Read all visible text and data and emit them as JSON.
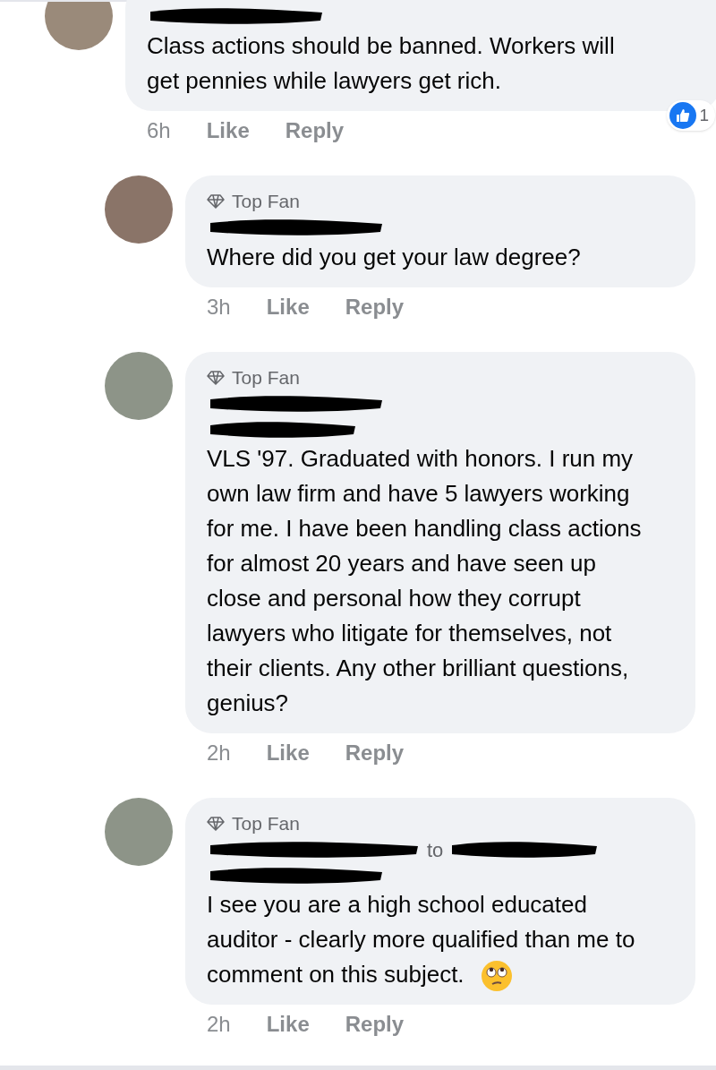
{
  "comments": [
    {
      "kind": "top-level",
      "body": "Class actions should be banned. Workers will get pennies while lawyers get rich.",
      "time": "6h",
      "like": "Like",
      "reply": "Reply",
      "reaction_count": "1"
    },
    {
      "kind": "reply",
      "badge": "Top Fan",
      "body": "Where did you get your law degree?",
      "time": "3h",
      "like": "Like",
      "reply": "Reply"
    },
    {
      "kind": "reply",
      "badge": "Top Fan",
      "body_redacted_prefix": true,
      "body": "VLS '97.  Graduated with honors.  I run my own law firm and have 5 lawyers working for me. I have been handling class actions for almost 20 years and have seen up close and personal how they corrupt lawyers who litigate for themselves, not their clients.  Any other brilliant questions, genius?",
      "time": "2h",
      "like": "Like",
      "reply": "Reply"
    },
    {
      "kind": "reply",
      "badge": "Top Fan",
      "recipient": "to",
      "body_redacted_prefix": true,
      "body": "I see you are a high school educated auditor - clearly more qualified than me to comment on this subject.",
      "emoji": true,
      "time": "2h",
      "like": "Like",
      "reply": "Reply"
    }
  ]
}
